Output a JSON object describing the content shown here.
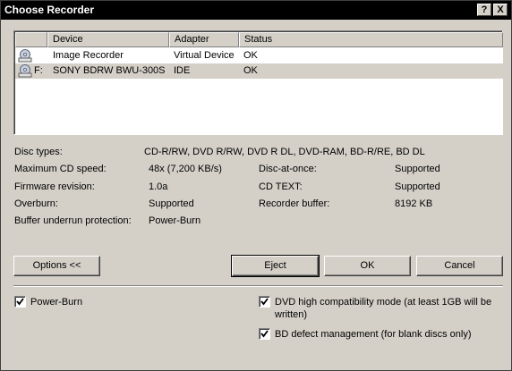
{
  "window": {
    "title": "Choose Recorder"
  },
  "titlebar_buttons": {
    "help": "?",
    "close": "X"
  },
  "list": {
    "columns": [
      "Device",
      "Adapter",
      "Status"
    ],
    "rows": [
      {
        "drive": "",
        "device": "Image Recorder",
        "adapter": "Virtual Device",
        "status": "OK",
        "selected": false
      },
      {
        "drive": "F:",
        "device": "SONY BDRW BWU-300S",
        "adapter": "IDE",
        "status": "OK",
        "selected": true
      }
    ]
  },
  "info": {
    "disc_types_label": "Disc types:",
    "disc_types_value": "CD-R/RW, DVD R/RW, DVD R DL, DVD-RAM, BD-R/RE, BD DL",
    "max_speed_label": "Maximum CD speed:",
    "max_speed_value": "48x (7,200 KB/s)",
    "firmware_label": "Firmware revision:",
    "firmware_value": "1.0a",
    "overburn_label": "Overburn:",
    "overburn_value": "Supported",
    "buffer_protect_label": "Buffer underrun protection:",
    "buffer_protect_value": "Power-Burn",
    "dao_label": "Disc-at-once:",
    "dao_value": "Supported",
    "cdtext_label": "CD TEXT:",
    "cdtext_value": "Supported",
    "recbuf_label": "Recorder buffer:",
    "recbuf_value": "8192 KB"
  },
  "buttons": {
    "options": "Options <<",
    "eject": "Eject",
    "ok": "OK",
    "cancel": "Cancel"
  },
  "options": {
    "power_burn": {
      "label": "Power-Burn",
      "checked": true
    },
    "dvd_compat": {
      "label_line1": "DVD high compatibility mode (at least 1GB will be",
      "label_line2": "written)",
      "checked": true
    },
    "bd_defect": {
      "label": "BD defect management (for blank discs only)",
      "checked": true
    }
  }
}
